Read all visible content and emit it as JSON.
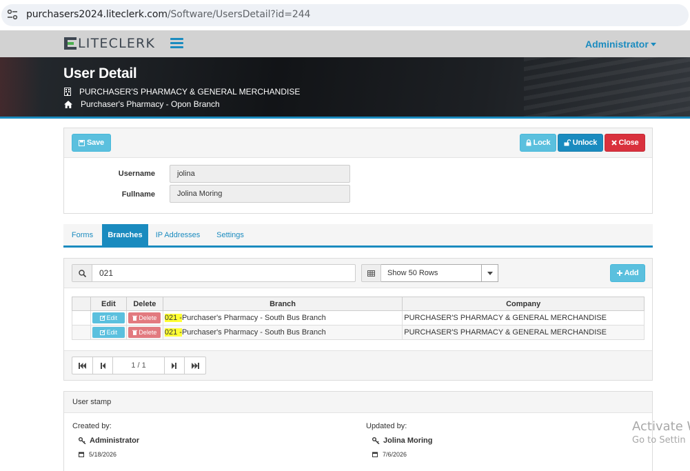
{
  "browser": {
    "url_host": "purchasers2024.liteclerk.com",
    "url_path": "/Software/UsersDetail?id=244"
  },
  "navbar": {
    "logo_text": "LITECLERK",
    "user_menu": "Administrator"
  },
  "header": {
    "title": "User Detail",
    "company": "PURCHASER'S PHARMACY & GENERAL MERCHANDISE",
    "branch": "Purchaser's Pharmacy - Opon Branch"
  },
  "toolbar": {
    "save_label": "Save",
    "lock_label": "Lock",
    "unlock_label": "Unlock",
    "close_label": "Close"
  },
  "form": {
    "username_label": "Username",
    "username_value": "jolina",
    "fullname_label": "Fullname",
    "fullname_value": "Jolina Moring"
  },
  "tabs": [
    {
      "label": "Forms",
      "active": false
    },
    {
      "label": "Branches",
      "active": true
    },
    {
      "label": "IP Addresses",
      "active": false
    },
    {
      "label": "Settings",
      "active": false
    }
  ],
  "branches": {
    "search_value": "021",
    "rows_select": "Show 50 Rows",
    "add_label": "Add",
    "columns": {
      "edit": "Edit",
      "delete": "Delete",
      "branch": "Branch",
      "company": "Company"
    },
    "edit_btn": "Edit",
    "delete_btn": "Delete",
    "rows": [
      {
        "code": "021 -",
        "branch": "Purchaser's Pharmacy - South Bus Branch",
        "company": "PURCHASER'S PHARMACY & GENERAL MERCHANDISE"
      },
      {
        "code": "021 -",
        "branch": "Purchaser's Pharmacy - South Bus Branch",
        "company": "PURCHASER'S PHARMACY & GENERAL MERCHANDISE"
      }
    ],
    "page_info": "1 / 1"
  },
  "stamp": {
    "title": "User stamp",
    "created_label": "Created by:",
    "created_by": "Administrator",
    "created_date": "5/18/2026",
    "updated_label": "Updated by:",
    "updated_by": "Jolina Moring",
    "updated_date": "7/6/2026"
  },
  "watermark": {
    "line1": "Activate W",
    "line2": "Go to Settin"
  },
  "colors": {
    "primary": "#1a8bbf",
    "info": "#5bc0de",
    "danger": "#d9313d",
    "highlight": "#ffff33"
  }
}
